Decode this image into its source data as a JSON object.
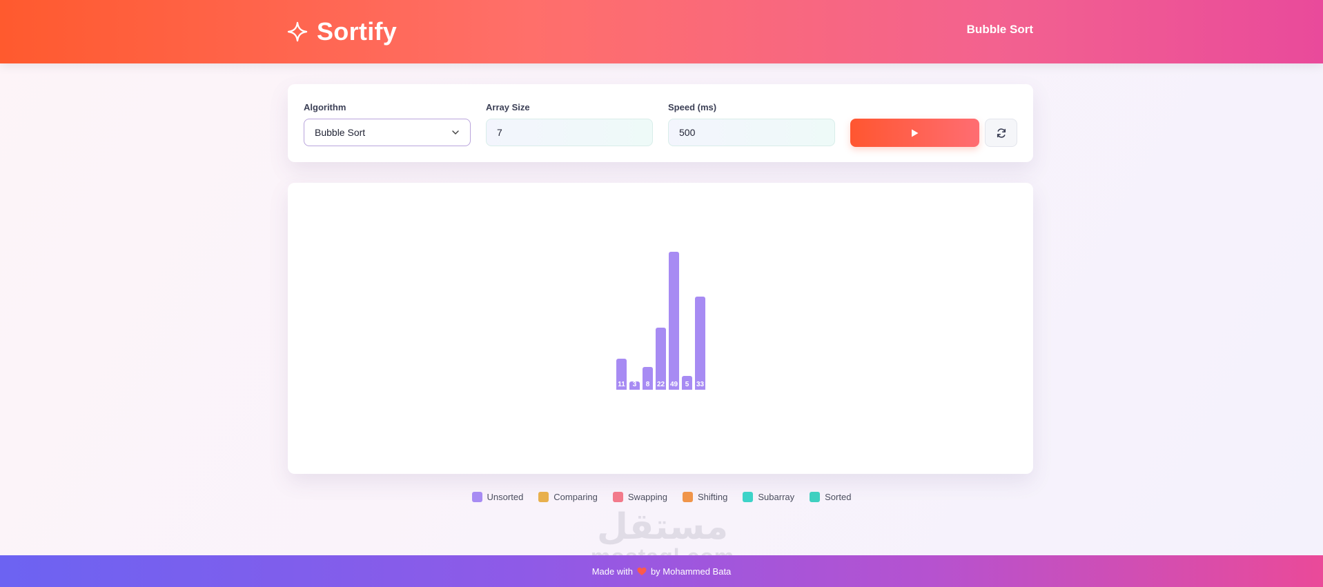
{
  "header": {
    "brand": "Sortify",
    "current_algorithm": "Bubble Sort"
  },
  "controls": {
    "algorithm": {
      "label": "Algorithm",
      "value": "Bubble Sort"
    },
    "array_size": {
      "label": "Array Size",
      "value": "7"
    },
    "speed": {
      "label": "Speed (ms)",
      "value": "500"
    },
    "play_icon": "play-icon",
    "reset_icon": "refresh-icon"
  },
  "chart_data": {
    "type": "bar",
    "values": [
      11,
      3,
      8,
      22,
      49,
      5,
      33
    ],
    "labels": [
      "11",
      "3",
      "8",
      "22",
      "49",
      "5",
      "33"
    ],
    "color": "#a78bf3"
  },
  "legend": [
    {
      "label": "Unsorted",
      "color": "#a78bf3"
    },
    {
      "label": "Comparing",
      "color": "#e8b04d"
    },
    {
      "label": "Swapping",
      "color": "#f27a8b"
    },
    {
      "label": "Shifting",
      "color": "#f0954a"
    },
    {
      "label": "Subarray",
      "color": "#3dd3c8"
    },
    {
      "label": "Sorted",
      "color": "#3fd0c0"
    }
  ],
  "watermark": {
    "logo": "مستقل",
    "text": "mostaql.com"
  },
  "footer": {
    "prefix": "Made with",
    "suffix": "by Mohammed Bata",
    "heart_color": "#ff5a4a"
  }
}
